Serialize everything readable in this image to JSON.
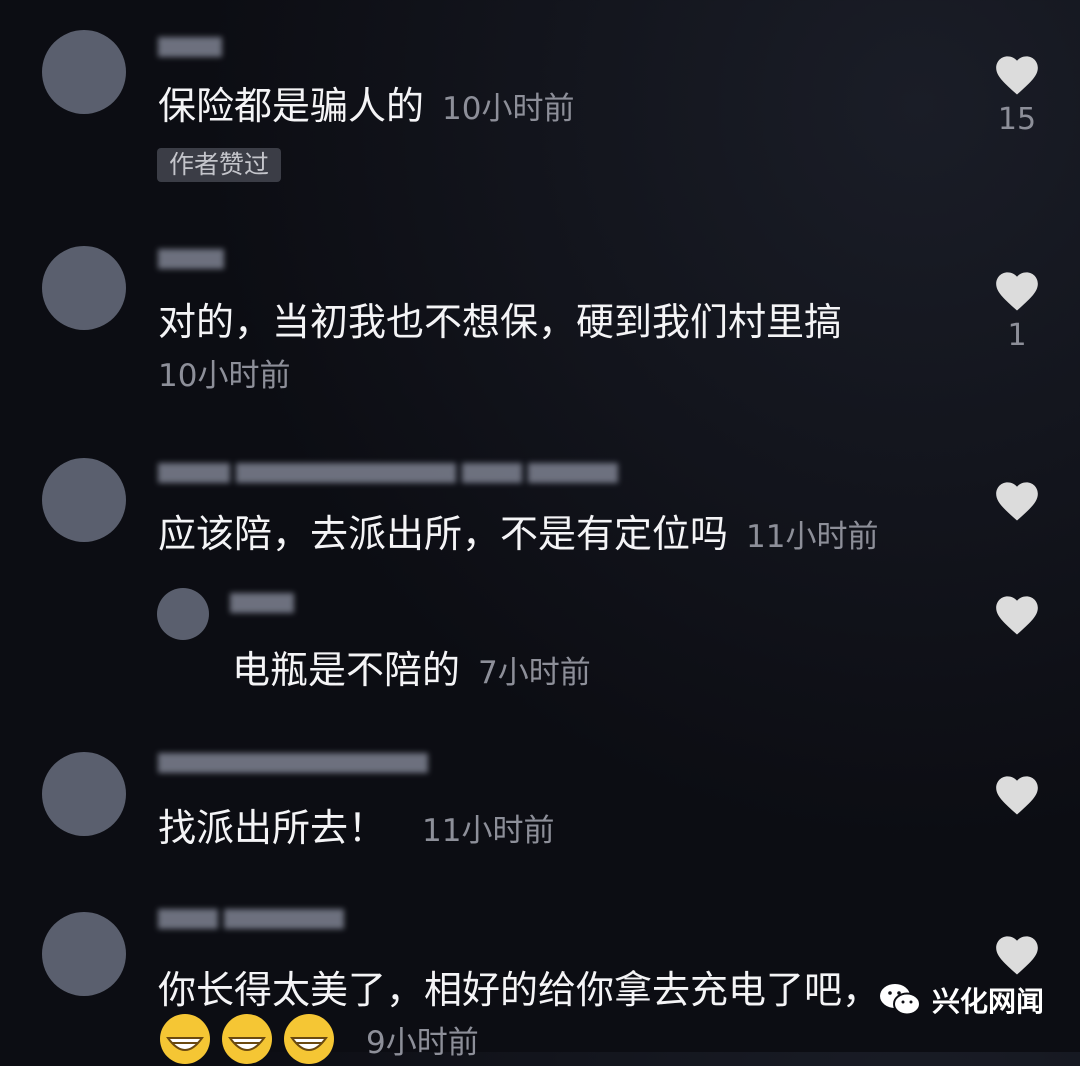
{
  "comments": [
    {
      "text": "保险都是骗人的",
      "time": "10小时前",
      "badge": "作者赞过",
      "likes": "15"
    },
    {
      "text": "对的，当初我也不想保，硬到我们村里搞",
      "time": "10小时前",
      "likes": "1"
    },
    {
      "text": "应该陪，去派出所，不是有定位吗",
      "time": "11小时前",
      "likes": ""
    },
    {
      "text": "电瓶是不陪的",
      "time": "7小时前",
      "likes": "",
      "reply": true
    },
    {
      "text": "找派出所去！",
      "time": "11小时前",
      "likes": ""
    },
    {
      "text": "你长得太美了，相好的给你拿去充电了吧，",
      "time": "9小时前",
      "likes": "",
      "emoji": "grinning-face-icon"
    }
  ],
  "watermark": {
    "text": "兴化网闻",
    "icon": "wechat-icon"
  },
  "colors": {
    "background": "#0c0d13",
    "avatar": "#5a5f6e",
    "secondary_text": "#8d8f99",
    "heart": "#dcdcdc"
  }
}
